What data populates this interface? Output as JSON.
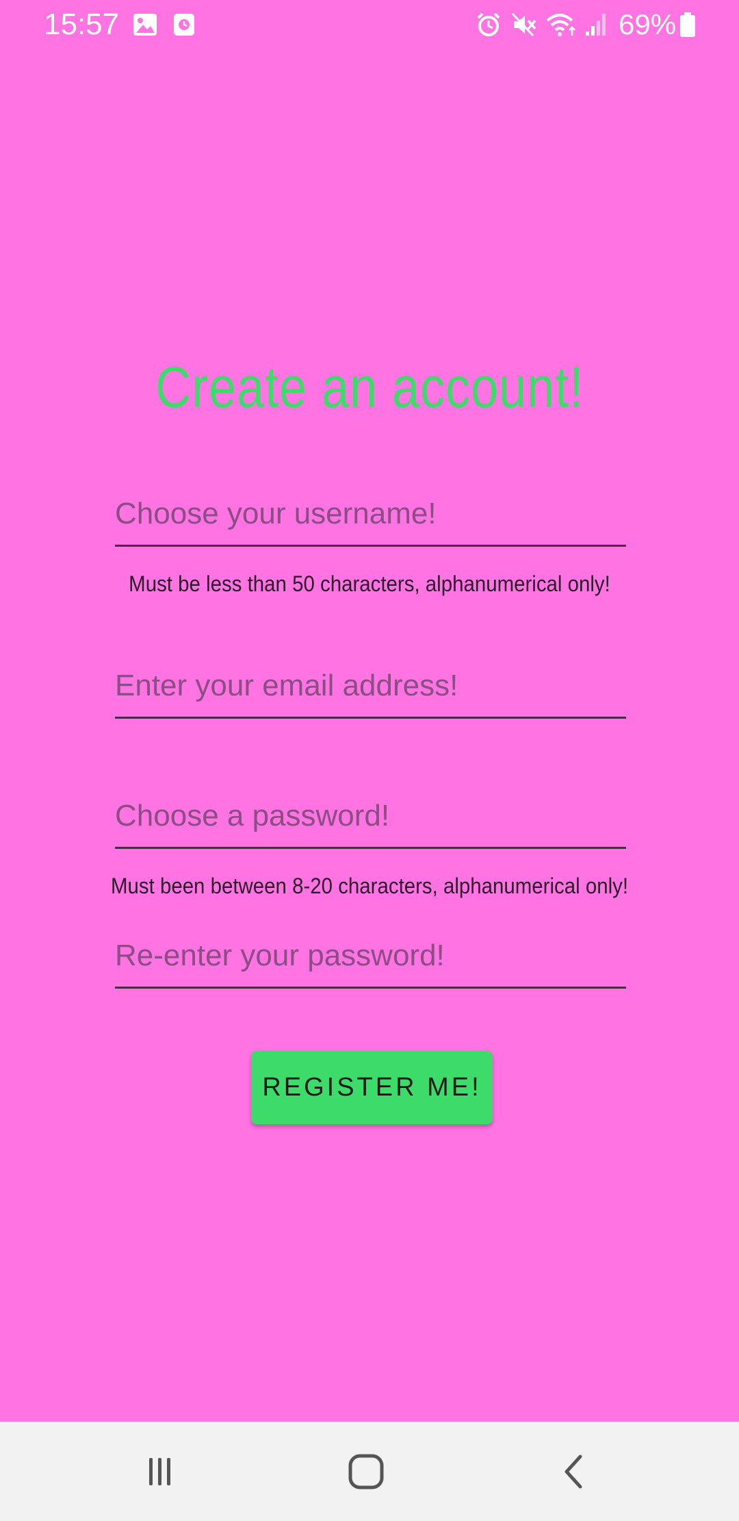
{
  "status_bar": {
    "time": "15:57",
    "battery": "69%",
    "icons": [
      "image-icon",
      "clock-app-icon",
      "alarm-icon",
      "mute-icon",
      "wifi-icon",
      "signal-icon",
      "battery-icon"
    ]
  },
  "form": {
    "title": "Create an account!",
    "username_placeholder": "Choose your username!",
    "username_hint": "Must be less than 50 characters, alphanumerical only!",
    "email_placeholder": "Enter your email address!",
    "password_placeholder": "Choose a password!",
    "password_hint": "Must been between 8-20 characters, alphanumerical only!",
    "confirm_password_placeholder": "Re-enter your password!",
    "register_label": "REGISTER ME!"
  },
  "colors": {
    "background": "#ff73e2",
    "accent": "#3ddc6a",
    "nav_bar": "#f2f2f2"
  },
  "nav_bar": {
    "icons": [
      "recent-apps-icon",
      "home-icon",
      "back-icon"
    ]
  }
}
